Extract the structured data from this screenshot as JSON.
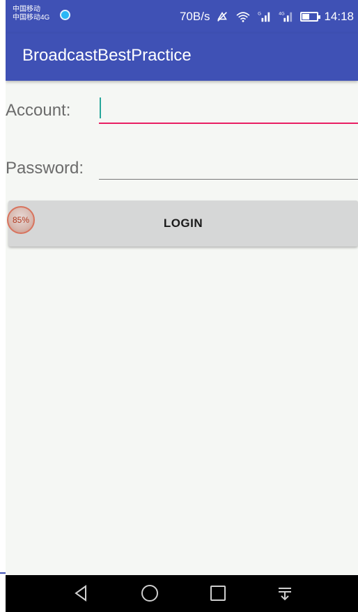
{
  "status_bar": {
    "carrier_line1": "中国移动",
    "carrier_line2": "中国移动4G",
    "net_speed": "70B/s",
    "time": "14:18",
    "icons": [
      "app-circle-icon",
      "mute-icon",
      "wifi-icon",
      "signal-g-icon",
      "signal-4g-icon",
      "battery-icon"
    ]
  },
  "app_bar": {
    "title": "BroadcastBestPractice"
  },
  "form": {
    "account_label": "Account:",
    "account_value": "",
    "password_label": "Password:",
    "password_value": "",
    "login_label": "LOGIN"
  },
  "overlay": {
    "memory_percent": "85%"
  },
  "nav_bar": {
    "icons": [
      "back-icon",
      "home-icon",
      "recents-icon",
      "notification-pull-icon"
    ]
  },
  "colors": {
    "primary": "#3f51b5",
    "accent": "#e91e63",
    "background": "#f5f7f4",
    "button": "#d6d7d7"
  }
}
